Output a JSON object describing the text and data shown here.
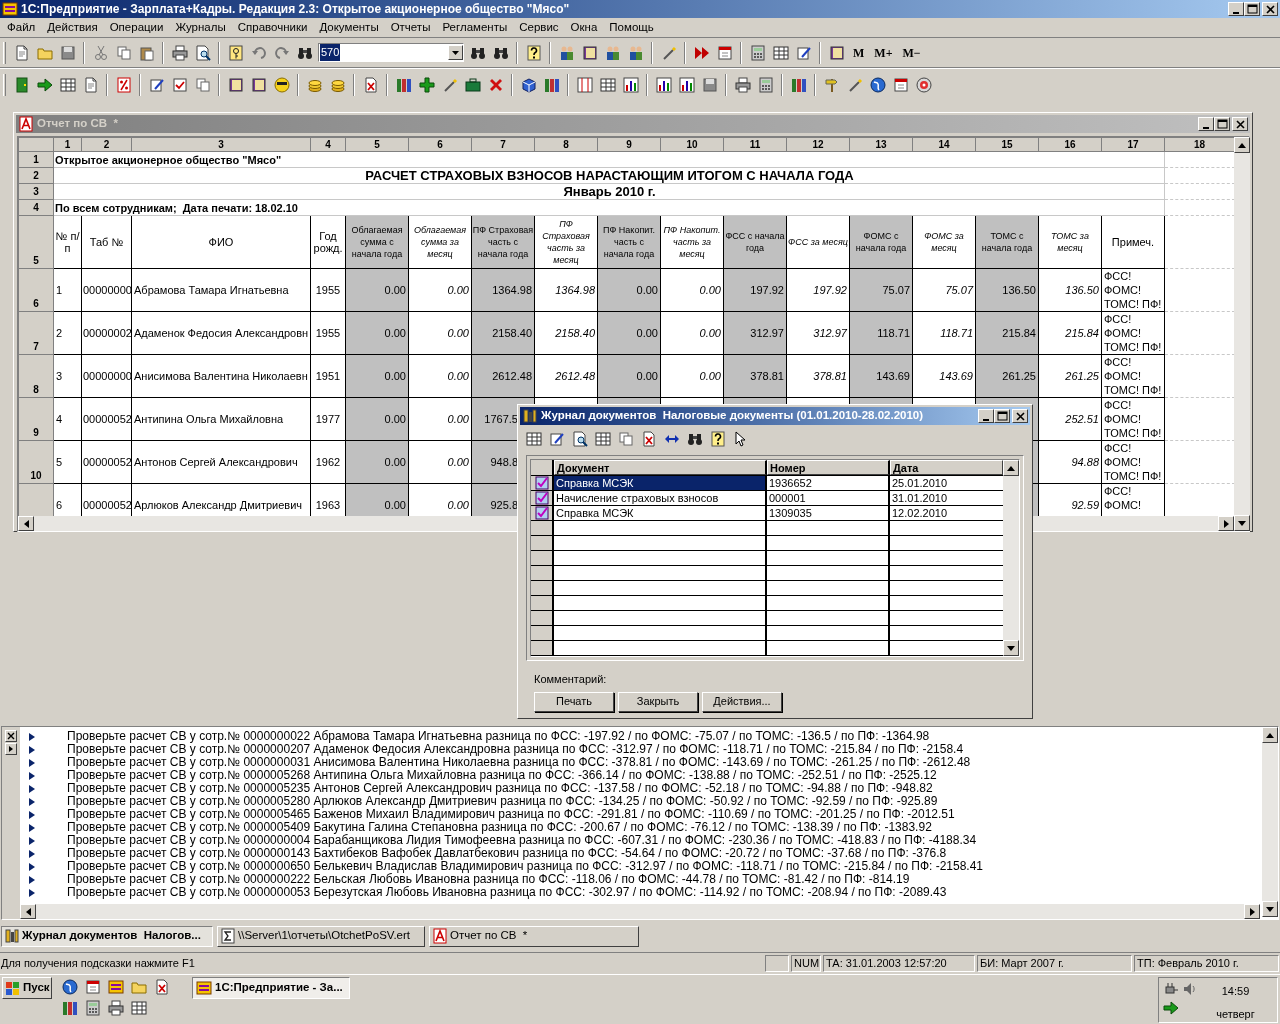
{
  "app_title": "1С:Предприятие - Зарплата+Кадры. Редакция 2.3: Открытое акционерное общество \"Мясо\"",
  "menu": [
    "Файл",
    "Действия",
    "Операции",
    "Журналы",
    "Справочники",
    "Документы",
    "Отчеты",
    "Регламенты",
    "Сервис",
    "Окна",
    "Помощь"
  ],
  "toolbar": {
    "search_value": "570",
    "memory_buttons": [
      "M",
      "M+",
      "M−"
    ]
  },
  "report_window": {
    "title": "Отчет по СВ  *",
    "active": false,
    "column_headers": [
      "1",
      "2",
      "3",
      "4",
      "5",
      "6",
      "7",
      "8",
      "9",
      "10",
      "11",
      "12",
      "13",
      "14",
      "15",
      "16",
      "17",
      "18"
    ],
    "row_headers": [
      "1",
      "2",
      "3",
      "4",
      "5",
      "6",
      "7",
      "8",
      "9",
      "10"
    ],
    "company": "Открытое акционерное общество \"Мясо\"",
    "title_line_1": "РАСЧЕТ СТРАХОВЫХ ВЗНОСОВ НАРАСТАЮЩИМ ИТОГОМ С НАЧАЛА ГОДА",
    "title_line_2": "Январь 2010 г.",
    "filter_line": "По всем сотрудникам;  Дата печати: 18.02.10",
    "table_headers": [
      "№ п/п",
      "Таб №",
      "ФИО",
      "Год рожд.",
      "Облагаемая сумма с начала года",
      "Облагаемая сумма за месяц",
      "ПФ Страховая часть с начала года",
      "ПФ Страховая часть за месяц",
      "ПФ Накопит. часть с начала года",
      "ПФ Накопит. часть за месяц",
      "ФСС с начала года",
      "ФСС за месяц",
      "ФОМС с начала года",
      "ФОМС за месяц",
      "ТОМС с начала года",
      "ТОМС за месяц",
      "Примеч."
    ],
    "rows": [
      {
        "cells": [
          "1",
          "00000000",
          "Абрамова Тамара Игнатьевна",
          "1955",
          "0.00",
          "0.00",
          "1364.98",
          "1364.98",
          "0.00",
          "0.00",
          "197.92",
          "197.92",
          "75.07",
          "75.07",
          "136.50",
          "136.50",
          "ФСС!\nФОМС!\nТОМС! ПФ!"
        ]
      },
      {
        "cells": [
          "2",
          "00000002",
          "Адаменок Федосия Александровн",
          "1955",
          "0.00",
          "0.00",
          "2158.40",
          "2158.40",
          "0.00",
          "0.00",
          "312.97",
          "312.97",
          "118.71",
          "118.71",
          "215.84",
          "215.84",
          "ФСС!\nФОМС!\nТОМС! ПФ!"
        ]
      },
      {
        "cells": [
          "3",
          "00000000",
          "Анисимова Валентина Николаевн",
          "1951",
          "0.00",
          "0.00",
          "2612.48",
          "2612.48",
          "0.00",
          "0.00",
          "378.81",
          "378.81",
          "143.69",
          "143.69",
          "261.25",
          "261.25",
          "ФСС!\nФОМС!\nТОМС! ПФ!"
        ]
      },
      {
        "cells": [
          "4",
          "00000052",
          "Антипина Ольга Михайловна",
          "1977",
          "0.00",
          "0.00",
          "1767.5",
          null,
          null,
          null,
          null,
          null,
          null,
          null,
          null,
          "252.51",
          "ФСС!\nФОМС!\nТОМС! ПФ!"
        ]
      },
      {
        "cells": [
          "5",
          "00000052",
          "Антонов Сергей Александрович",
          "1962",
          "0.00",
          "0.00",
          "948.8",
          null,
          null,
          null,
          null,
          null,
          null,
          null,
          null,
          "94.88",
          "ФСС!\nФОМС!\nТОМС! ПФ!"
        ]
      },
      {
        "cells": [
          "6",
          "00000052",
          "Арлюков Александр Дмитриевич",
          "1963",
          "0.00",
          "0.00",
          "925.8",
          null,
          null,
          null,
          null,
          null,
          null,
          null,
          null,
          "92.59",
          "ФСС!\nФОМС!"
        ]
      }
    ]
  },
  "dialog": {
    "title": "Журнал документов  Налоговые документы (01.01.2010-28.02.2010)",
    "active": true,
    "columns": [
      "Документ",
      "Номер",
      "Дата"
    ],
    "rows": [
      {
        "cells": [
          "Справка МСЭК",
          "1936652",
          "25.01.2010"
        ],
        "selected": true
      },
      {
        "cells": [
          "Начисление страховых взносов",
          "000001",
          "31.01.2010"
        ],
        "selected": false
      },
      {
        "cells": [
          "Справка МСЭК",
          "1309035",
          "12.02.2010"
        ],
        "selected": false
      }
    ],
    "comment_label": "Комментарий:",
    "buttons": [
      "Печать",
      "Закрыть",
      "Действия..."
    ]
  },
  "messages": [
    "Проверьте расчет СВ у сотр.№ 0000000022 Абрамова Тамара Игнатьевна разница по ФСС: -197.92 / по ФОМС: -75.07 / по ТОМС: -136.5 / по ПФ: -1364.98",
    "Проверьте расчет СВ у сотр.№ 0000000207 Адаменок Федосия Александровна разница по ФСС: -312.97 / по ФОМС: -118.71 / по ТОМС: -215.84 / по ПФ: -2158.4",
    "Проверьте расчет СВ у сотр.№ 0000000031 Анисимова Валентина Николаевна разница по ФСС: -378.81 / по ФОМС: -143.69 / по ТОМС: -261.25 / по ПФ: -2612.48",
    "Проверьте расчет СВ у сотр.№ 0000005268 Антипина Ольга Михайловна разница по ФСС: -366.14 / по ФОМС: -138.88 / по ТОМС: -252.51 / по ПФ: -2525.12",
    "Проверьте расчет СВ у сотр.№ 0000005235 Антонов Сергей Александрович разница по ФСС: -137.58 / по ФОМС: -52.18 / по ТОМС: -94.88 / по ПФ: -948.82",
    "Проверьте расчет СВ у сотр.№ 0000005280 Арлюков Александр Дмитриевич разница по ФСС: -134.25 / по ФОМС: -50.92 / по ТОМС: -92.59 / по ПФ: -925.89",
    "Проверьте расчет СВ у сотр.№ 0000005465 Баженов Михаил Владимирович разница по ФСС: -291.81 / по ФОМС: -110.69 / по ТОМС: -201.25 / по ПФ: -2012.51",
    "Проверьте расчет СВ у сотр.№ 0000005409 Бакутина Галина Степановна разница по ФСС: -200.67 / по ФОМС: -76.12 / по ТОМС: -138.39 / по ПФ: -1383.92",
    "Проверьте расчет СВ у сотр.№ 0000000004 Барабанщикова Лидия Тимофеевна разница по ФСС: -607.31 / по ФОМС: -230.36 / по ТОМС: -418.83 / по ПФ: -4188.34",
    "Проверьте расчет СВ у сотр.№ 0000000143 Бахтибеков Вафобек Давлатбекович разница по ФСС: -54.64 / по ФОМС: -20.72 / по ТОМС: -37.68 / по ПФ: -376.8",
    "Проверьте расчет СВ у сотр.№ 0000000650 Белькевич Владислав Владимирович разница по ФСС: -312.97 / по ФОМС: -118.71 / по ТОМС: -215.84 / по ПФ: -2158.41",
    "Проверьте расчет СВ у сотр.№ 0000000222 Бельская Любовь Ивановна разница по ФСС: -118.06 / по ФОМС: -44.78 / по ТОМС: -81.42 / по ПФ: -814.19",
    "Проверьте расчет СВ у сотр.№ 0000000053 Березутская Любовь Ивановна разница по ФСС: -302.97 / по ФОМС: -114.92 / по ТОМС: -208.94 / по ПФ: -2089.43"
  ],
  "window_tabs": [
    {
      "label": "Журнал документов  Налогов...",
      "kind": "journal",
      "selected": true
    },
    {
      "label": "\\\\Server\\1\\отчеты\\OtchetPoSV.ert",
      "kind": "module",
      "selected": false
    },
    {
      "label": "Отчет по СВ  *",
      "kind": "report",
      "selected": false
    }
  ],
  "status_bar": {
    "hint": "Для получения подсказки нажмите F1",
    "panels": [
      "NUM",
      "ТА: 31.01.2003 12:57:20",
      "БИ: Март 2007 г.",
      "ТП: Февраль 2010 г."
    ]
  },
  "taskbar": {
    "start": "Пуск",
    "tasks": [
      {
        "label": "1С:Предприятие - За...",
        "selected": true
      }
    ],
    "clock": "14:59",
    "day": "четверг"
  }
}
